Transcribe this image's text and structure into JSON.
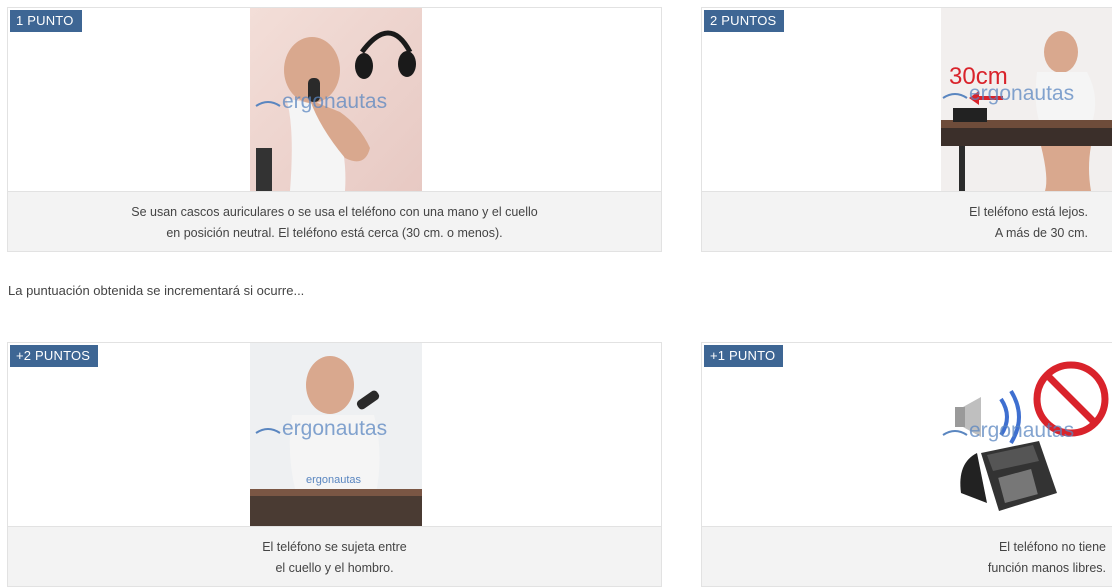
{
  "cards": [
    {
      "badge": "1 PUNTO",
      "caption_lines": [
        "Se usan cascos auriculares o se usa el teléfono con una mano y el cuello",
        "en posición neutral. El teléfono está cerca (30 cm. o menos)."
      ]
    },
    {
      "badge": "2 PUNTOS",
      "caption_lines": [
        "El teléfono está lejos.",
        "A más de 30 cm."
      ],
      "distance_label": "30cm"
    },
    {
      "badge": "+2 PUNTOS",
      "caption_lines": [
        "El teléfono se sujeta entre",
        "el cuello y el hombro."
      ]
    },
    {
      "badge": "+1 PUNTO",
      "caption_lines": [
        "El teléfono no tiene",
        "función manos libres."
      ]
    }
  ],
  "intro_text": "La puntuación obtenida se incrementará si ocurre...",
  "watermark": "ergonautas",
  "colors": {
    "badge": "#3e6694",
    "caption_bg": "#f3f3f3",
    "border": "#e2e2e2",
    "watermark": "#5a86c0",
    "prohibited": "#d9232b"
  }
}
